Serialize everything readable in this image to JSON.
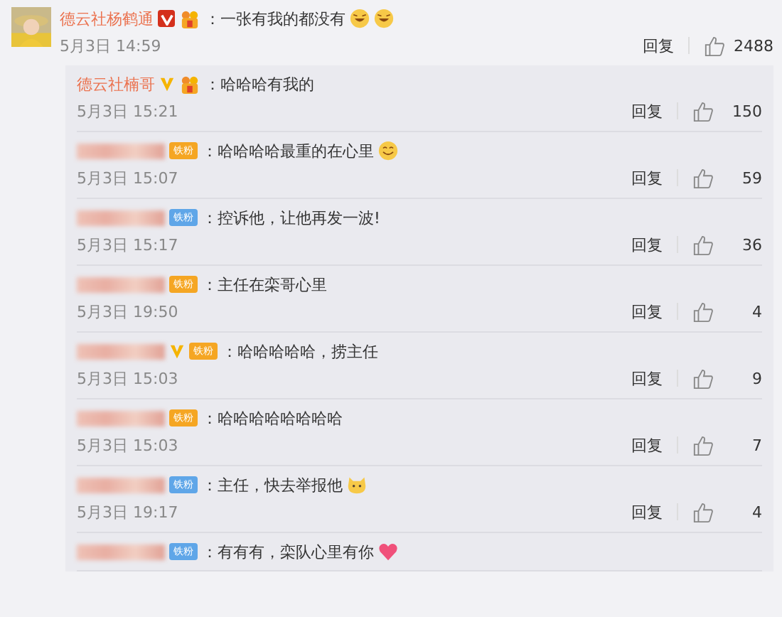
{
  "comment": {
    "author": "德云社杨鹤通",
    "badges": [
      {
        "kind": "v-red"
      },
      {
        "kind": "fan-icon"
      }
    ],
    "text": "：一张有我的都没有",
    "emoji": [
      {
        "kind": "laugh"
      },
      {
        "kind": "laugh"
      }
    ],
    "date": "5月3日 14:59",
    "reply": "回复",
    "likes": "2488"
  },
  "replies": [
    {
      "author": "德云社楠哥",
      "badges": [
        {
          "kind": "v-gold"
        },
        {
          "kind": "fan-icon"
        }
      ],
      "text": "：哈哈哈有我的",
      "date": "5月3日 15:21",
      "reply": "回复",
      "likes": "150"
    },
    {
      "author_blurred": true,
      "badges": [
        {
          "kind": "fan-gold",
          "label": "铁粉"
        }
      ],
      "text": "：哈哈哈哈最重的在心里",
      "emoji": [
        {
          "kind": "smile"
        }
      ],
      "date": "5月3日 15:07",
      "reply": "回复",
      "likes": "59"
    },
    {
      "author_blurred": true,
      "badges": [
        {
          "kind": "fan-blue",
          "label": "铁粉"
        }
      ],
      "text": "：控诉他，让他再发一波!",
      "date": "5月3日 15:17",
      "reply": "回复",
      "likes": "36"
    },
    {
      "author_blurred": true,
      "badges": [
        {
          "kind": "fan-gold",
          "label": "铁粉"
        }
      ],
      "text": "：主任在栾哥心里",
      "date": "5月3日 19:50",
      "reply": "回复",
      "likes": "4"
    },
    {
      "author_blurred": true,
      "badges": [
        {
          "kind": "v-gold"
        },
        {
          "kind": "fan-gold",
          "label": "铁粉"
        }
      ],
      "text": "：哈哈哈哈哈，捞主任",
      "date": "5月3日 15:03",
      "reply": "回复",
      "likes": "9"
    },
    {
      "author_blurred": true,
      "badges": [
        {
          "kind": "fan-gold",
          "label": "铁粉"
        }
      ],
      "text": "：哈哈哈哈哈哈哈哈",
      "date": "5月3日 15:03",
      "reply": "回复",
      "likes": "7"
    },
    {
      "author_blurred": true,
      "badges": [
        {
          "kind": "fan-blue",
          "label": "铁粉"
        }
      ],
      "text": "：主任，快去举报他",
      "emoji": [
        {
          "kind": "cat"
        }
      ],
      "date": "5月3日 19:17",
      "reply": "回复",
      "likes": "4"
    },
    {
      "author_blurred": true,
      "badges": [
        {
          "kind": "fan-blue",
          "label": "铁粉"
        }
      ],
      "text": "：有有有，栾队心里有你",
      "emoji": [
        {
          "kind": "heart"
        }
      ]
    }
  ]
}
